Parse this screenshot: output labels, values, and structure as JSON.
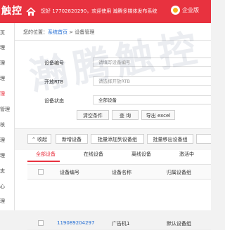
{
  "header": {
    "logo": "触控",
    "greeting": "您好 17702820290，欢迎使用 瀚腾多媒体发布系统",
    "vip_label": "企业版"
  },
  "sidebar": {
    "items": [
      {
        "label": "页"
      },
      {
        "label": "理"
      },
      {
        "label": "理"
      },
      {
        "label": "理"
      },
      {
        "label": "理",
        "active": true
      },
      {
        "label": "管理"
      },
      {
        "label": "核"
      },
      {
        "label": "理"
      },
      {
        "label": "理"
      },
      {
        "label": "志"
      },
      {
        "label": "心"
      },
      {
        "label": "理"
      }
    ]
  },
  "breadcrumb": {
    "prefix": "您的位置：",
    "home": "系统首页",
    "sep": " > ",
    "current": "设备管理"
  },
  "form": {
    "device_id_label": "设备编号",
    "device_id_placeholder": "请填写设备编号",
    "rtb_label": "开放RTB",
    "rtb_value": "请选择开放RTB",
    "status_label": "设备状态",
    "status_value": "全部设备",
    "clear_button": "清空条件",
    "query_button": "查 询",
    "export_button": "导出 excel"
  },
  "toolbar": {
    "collapse": "收起",
    "add_device": "新增设备",
    "batch_add": "批量添加到设备组",
    "batch_remove": "批量移出设备组"
  },
  "tabs": [
    "全部设备",
    "在线设备",
    "离线设备",
    "激活中"
  ],
  "table": {
    "headers": [
      "设备编号",
      "设备名称",
      "归属设备组"
    ],
    "rows": [
      {
        "id": "119089204297",
        "name": "广告机1",
        "group": "默认设备组"
      }
    ]
  },
  "watermark": "瀚腾触控"
}
